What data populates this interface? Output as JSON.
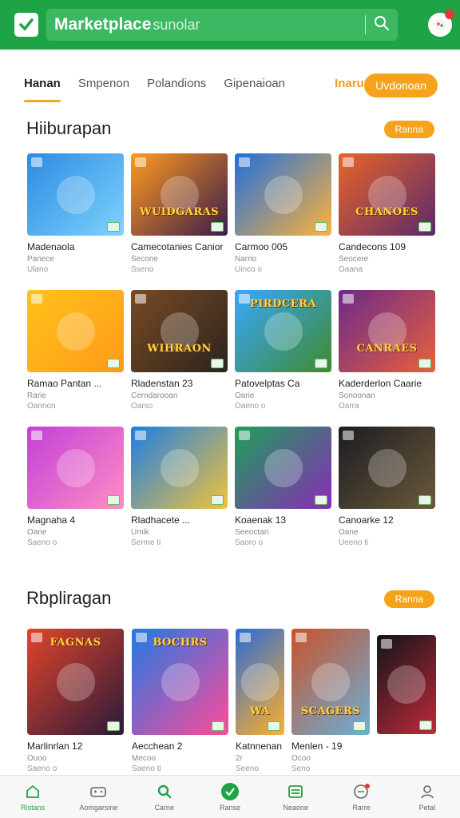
{
  "header": {
    "brand": "Marketplace",
    "search_placeholder": "sunolar"
  },
  "tabs": [
    {
      "label": "Hanan"
    },
    {
      "label": "Smpenon"
    },
    {
      "label": "Polandions"
    },
    {
      "label": "Gipenaioan"
    },
    {
      "label": "Inarup"
    }
  ],
  "tab_button": "Uvdonoan",
  "sections": [
    {
      "title": "Hiiburapan",
      "pill": "Ranna"
    },
    {
      "title": "Rbpliragan",
      "pill": "Ranna"
    }
  ],
  "grid1": [
    {
      "name": "Madenaola",
      "sub1": "Panece",
      "sub2": "Ulano",
      "art_text": "",
      "colors": [
        "#2b8be0",
        "#7fd3ff"
      ]
    },
    {
      "name": "Camecotanies Canior",
      "sub1": "Secone",
      "sub2": "Sseno",
      "art_text": "WUIDGARAS",
      "colors": [
        "#ff9a1f",
        "#3a1b4a"
      ]
    },
    {
      "name": "Carmoo 005",
      "sub1": "Narrio",
      "sub2": "Uinco o",
      "art_text": "",
      "colors": [
        "#1f6fe0",
        "#ffb23a"
      ]
    },
    {
      "name": "Candecons 109",
      "sub1": "Seocere",
      "sub2": "Oaana",
      "art_text": "CHANOES",
      "colors": [
        "#e8642a",
        "#5a2a6a"
      ]
    },
    {
      "name": "Ramao Pantan ...",
      "sub1": "Rarie",
      "sub2": "Oannon",
      "art_text": "",
      "colors": [
        "#ffc21a",
        "#ff9a1a"
      ]
    },
    {
      "name": "Rladenstan 23",
      "sub1": "Cerndarooan",
      "sub2": "Oarso",
      "art_text": "WIHRAON",
      "colors": [
        "#7a4a22",
        "#2a2420"
      ]
    },
    {
      "name": "Patovelptas Ca",
      "sub1": "Oarie",
      "sub2": "Oaeno o",
      "art_text": "PIRDCERA",
      "colors": [
        "#39a7ff",
        "#3e8a2e"
      ]
    },
    {
      "name": "Kaderderlon Caarie",
      "sub1": "Sonoonan",
      "sub2": "Oarra",
      "art_text": "CANRAES",
      "colors": [
        "#6a2a8a",
        "#e9603a"
      ]
    },
    {
      "name": "Magnaha 4",
      "sub1": "Oane",
      "sub2": "Saeno o",
      "art_text": "",
      "colors": [
        "#c33fd9",
        "#ff8ec3"
      ]
    },
    {
      "name": "Rladhacete ...",
      "sub1": "Umik",
      "sub2": "Serme ti",
      "art_text": "",
      "colors": [
        "#1d7ee6",
        "#f2c23a"
      ]
    },
    {
      "name": "Koaenak 13",
      "sub1": "Seeoctan",
      "sub2": "Saoro o",
      "art_text": "",
      "colors": [
        "#1ea05a",
        "#8a2ab8"
      ]
    },
    {
      "name": "Canoarke 12",
      "sub1": "Oane",
      "sub2": "Ueeno ti",
      "art_text": "",
      "colors": [
        "#1c1c22",
        "#6b5a3a"
      ]
    }
  ],
  "grid2": [
    {
      "name": "Marlinrlan 12",
      "sub1": "Ouoo",
      "sub2": "Saeno o",
      "art_text": "FAGNAS",
      "colors": [
        "#e2442a",
        "#2a1a3a"
      ]
    },
    {
      "name": "Aecchean 2",
      "sub1": "Mecoo",
      "sub2": "Saeno ti",
      "art_text": "BOCHRS",
      "colors": [
        "#1f7ae6",
        "#ff4a9a"
      ]
    },
    {
      "name": "Katnnenan",
      "sub1": "2r",
      "sub2": "Seeno",
      "art_text": "WA",
      "colors": [
        "#2a6ad8",
        "#ffb02a"
      ]
    },
    {
      "name": "Menlen - 19",
      "sub1": "Ocoo",
      "sub2": "Seno",
      "art_text": "SCAGERS",
      "colors": [
        "#c8522a",
        "#6ab0d8"
      ]
    },
    {
      "name": "",
      "sub1": "",
      "sub2": "",
      "art_text": "",
      "colors": [
        "#101418",
        "#c02a3a"
      ]
    }
  ],
  "bottom_nav": [
    {
      "label": "Ristans",
      "icon": "home-icon",
      "active": true
    },
    {
      "label": "Aomgarsine",
      "icon": "gamepad-icon",
      "active": false
    },
    {
      "label": "Carne",
      "icon": "search-icon",
      "active": false
    },
    {
      "label": "Ranse",
      "icon": "marketplace-icon",
      "active": false
    },
    {
      "label": "Neaone",
      "icon": "list-icon",
      "active": false
    },
    {
      "label": "Rarre",
      "icon": "notification-icon",
      "active": false
    },
    {
      "label": "Petal",
      "icon": "profile-icon",
      "active": false
    }
  ],
  "colors": {
    "primary": "#1ea446",
    "accent": "#f7a21b"
  }
}
